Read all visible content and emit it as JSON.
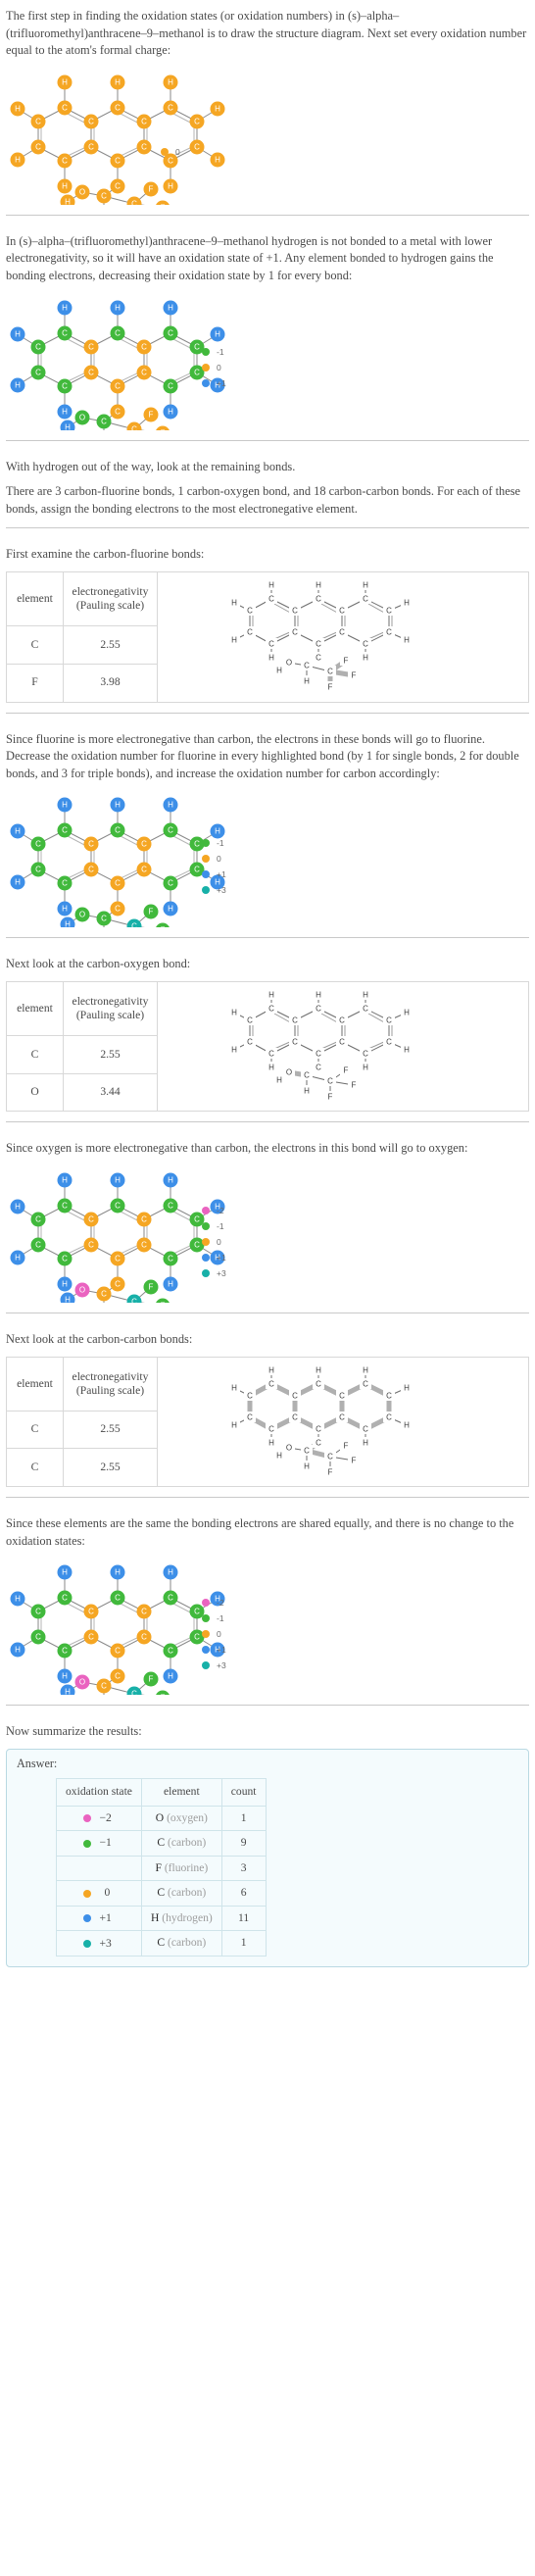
{
  "compound": "(s)-alpha-(trifluoromethyl)anthracene-9-methanol",
  "colors": {
    "orange": "#f5a623",
    "green": "#41b93c",
    "blue": "#3d8fe8",
    "pink": "#ea63c0",
    "teal": "#17b0a8",
    "skeleton": "#5a5a5a",
    "highlight": "#9b9b9b"
  },
  "steps": [
    {
      "id": "step1",
      "paragraphs": [
        "The first step in finding the oxidation states (or oxidation numbers) in (s)–alpha–(trifluoromethyl)anthracene–9–methanol is to draw the structure diagram. Next set every oxidation number equal to the atom's formal charge:"
      ],
      "legend": [
        {
          "color": "#f5a623",
          "label": "0"
        }
      ]
    },
    {
      "id": "step2",
      "paragraphs": [
        "In (s)–alpha–(trifluoromethyl)anthracene–9–methanol hydrogen is not bonded to a metal with lower electronegativity, so it will have an oxidation state of +1. Any element bonded to hydrogen gains the bonding electrons, decreasing their oxidation state by 1 for every bond:"
      ],
      "legend": [
        {
          "color": "#41b93c",
          "label": "-1"
        },
        {
          "color": "#f5a623",
          "label": "0"
        },
        {
          "color": "#3d8fe8",
          "label": "+1"
        }
      ]
    },
    {
      "id": "step3",
      "paragraphs": [
        "With hydrogen out of the way, look at the remaining bonds.",
        "There are 3 carbon-fluorine bonds, 1 carbon-oxygen bond, and 18 carbon-carbon bonds.  For each of these bonds, assign the bonding electrons to the most electronegative element."
      ]
    },
    {
      "id": "step4",
      "paragraphs": [
        "First examine the carbon-fluorine bonds:"
      ],
      "table": {
        "headers": [
          "element",
          "electronegativity (Pauling scale)"
        ],
        "header_lines": [
          [
            "element"
          ],
          [
            "electronegativity",
            "(Pauling scale)"
          ]
        ],
        "rows": [
          [
            "C",
            "2.55"
          ],
          [
            "F",
            "3.98"
          ]
        ]
      }
    },
    {
      "id": "step5",
      "paragraphs": [
        "Since fluorine is more electronegative than carbon, the electrons in these bonds will go to fluorine. Decrease the oxidation number for fluorine in every highlighted bond (by 1 for single bonds, 2 for double bonds, and 3 for triple bonds), and increase the oxidation number for carbon accordingly:"
      ],
      "legend": [
        {
          "color": "#41b93c",
          "label": "-1"
        },
        {
          "color": "#f5a623",
          "label": "0"
        },
        {
          "color": "#3d8fe8",
          "label": "+1"
        },
        {
          "color": "#17b0a8",
          "label": "+3"
        }
      ]
    },
    {
      "id": "step6",
      "paragraphs": [
        "Next look at the carbon-oxygen bond:"
      ],
      "table": {
        "headers": [
          "element",
          "electronegativity (Pauling scale)"
        ],
        "header_lines": [
          [
            "element"
          ],
          [
            "electronegativity",
            "(Pauling scale)"
          ]
        ],
        "rows": [
          [
            "C",
            "2.55"
          ],
          [
            "O",
            "3.44"
          ]
        ]
      }
    },
    {
      "id": "step7",
      "paragraphs": [
        "Since oxygen is more electronegative than carbon, the electrons in this bond will go to oxygen:"
      ],
      "legend": [
        {
          "color": "#ea63c0",
          "label": "-2"
        },
        {
          "color": "#41b93c",
          "label": "-1"
        },
        {
          "color": "#f5a623",
          "label": "0"
        },
        {
          "color": "#3d8fe8",
          "label": "+1"
        },
        {
          "color": "#17b0a8",
          "label": "+3"
        }
      ]
    },
    {
      "id": "step8",
      "paragraphs": [
        "Next look at the carbon-carbon bonds:"
      ],
      "table": {
        "headers": [
          "element",
          "electronegativity (Pauling scale)"
        ],
        "header_lines": [
          [
            "element"
          ],
          [
            "electronegativity",
            "(Pauling scale)"
          ]
        ],
        "rows": [
          [
            "C",
            "2.55"
          ],
          [
            "C",
            "2.55"
          ]
        ]
      }
    },
    {
      "id": "step9",
      "paragraphs": [
        "Since these elements are the same the bonding electrons are shared equally, and there is no change to the oxidation states:"
      ],
      "legend": [
        {
          "color": "#ea63c0",
          "label": "-2"
        },
        {
          "color": "#41b93c",
          "label": "-1"
        },
        {
          "color": "#f5a623",
          "label": "0"
        },
        {
          "color": "#3d8fe8",
          "label": "+1"
        },
        {
          "color": "#17b0a8",
          "label": "+3"
        }
      ]
    },
    {
      "id": "step10",
      "paragraphs": [
        "Now summarize the results:"
      ]
    }
  ],
  "answer": {
    "label": "Answer:",
    "headers": [
      "oxidation state",
      "element",
      "count"
    ],
    "rows": [
      {
        "dot": "#ea63c0",
        "state": "−2",
        "symbol": "O",
        "name": "(oxygen)",
        "count": "1"
      },
      {
        "dot": "#41b93c",
        "state": "−1",
        "symbol": "C",
        "name": "(carbon)",
        "count": "9"
      },
      {
        "dot": "",
        "state": "",
        "symbol": "F",
        "name": "(fluorine)",
        "count": "3"
      },
      {
        "dot": "#f5a623",
        "state": "0",
        "symbol": "C",
        "name": "(carbon)",
        "count": "6"
      },
      {
        "dot": "#3d8fe8",
        "state": "+1",
        "symbol": "H",
        "name": "(hydrogen)",
        "count": "11"
      },
      {
        "dot": "#17b0a8",
        "state": "+3",
        "symbol": "C",
        "name": "(carbon)",
        "count": "1"
      }
    ]
  }
}
